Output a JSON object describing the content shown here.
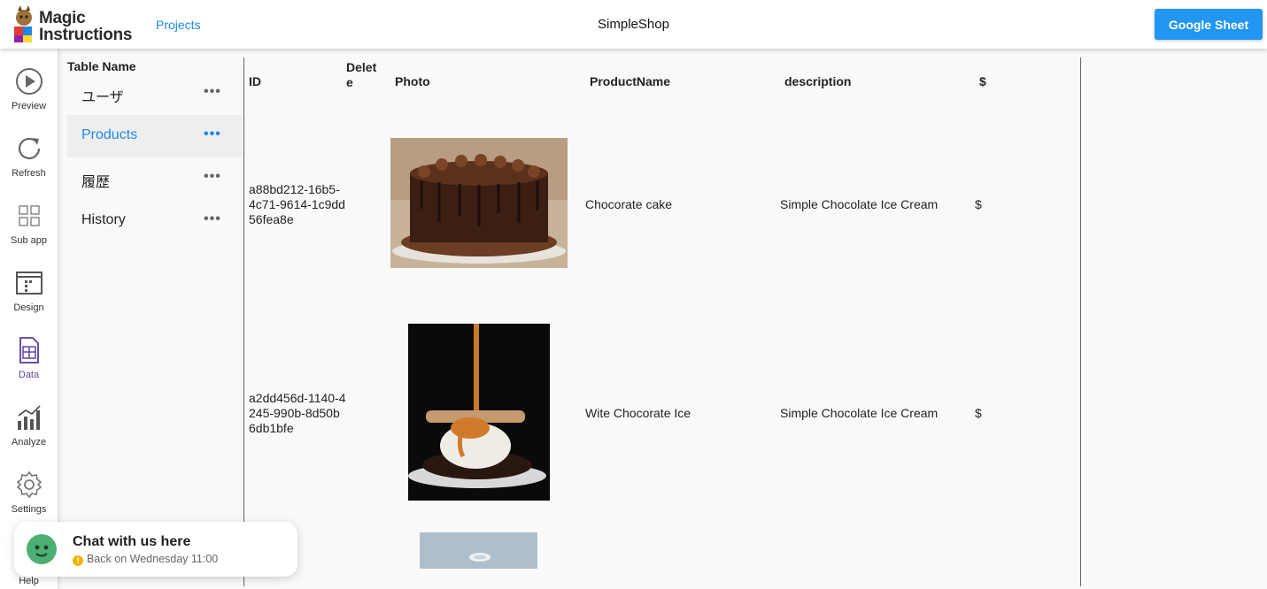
{
  "header": {
    "logo_text_line1": "Magic",
    "logo_text_line2": "Instructions",
    "projects_link": "Projects",
    "app_title": "SimpleShop",
    "google_sheet_button": "Google Sheet"
  },
  "leftnav": {
    "items": [
      {
        "label": "Preview",
        "icon": "play-circle-icon"
      },
      {
        "label": "Refresh",
        "icon": "refresh-icon"
      },
      {
        "label": "Sub app",
        "icon": "grid-icon"
      },
      {
        "label": "Design",
        "icon": "design-window-icon"
      },
      {
        "label": "Data",
        "icon": "data-sheet-icon",
        "active": true
      },
      {
        "label": "Analyze",
        "icon": "bar-chart-icon"
      },
      {
        "label": "Settings",
        "icon": "gear-icon"
      },
      {
        "label": "Help",
        "icon": "help-icon"
      }
    ]
  },
  "tables_panel": {
    "heading": "Table Name",
    "more_glyph": "•••",
    "items": [
      {
        "name": "ユーザ"
      },
      {
        "name": "Products",
        "active": true
      },
      {
        "name": "履歴"
      },
      {
        "name": "History"
      }
    ]
  },
  "grid": {
    "columns": [
      "ID",
      "Delete",
      "Photo",
      "ProductName",
      "description",
      "$"
    ],
    "rows": [
      {
        "id": "a88bd212-16b5-4c71-9614-1c9dd56fea8e",
        "photo": "chocolate-cake-photo",
        "product_name": "Chocorate cake",
        "description": "Simple Chocolate Ice Cream",
        "price": "$"
      },
      {
        "id": "a2dd456d-1140-4245-990b-8d50b6db1bfe",
        "photo": "ice-cream-caramel-photo",
        "product_name": "Wite Chocorate Ice",
        "description": "Simple Chocolate Ice Cream",
        "price": "$"
      },
      {
        "id": "",
        "photo": "milk-cup-photo",
        "product_name": "",
        "description": "",
        "price": ""
      }
    ]
  },
  "chat": {
    "title": "Chat with us here",
    "status_glyph": "!",
    "subtitle": "Back on Wednesday 11:00"
  }
}
